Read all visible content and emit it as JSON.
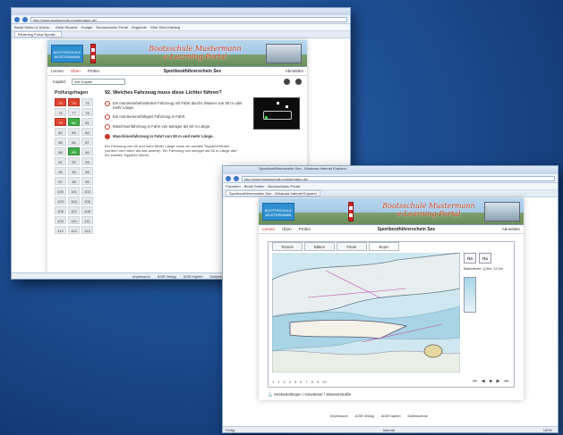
{
  "school": {
    "line1": "Bootsschule Mustermann",
    "line2": "e-Learning-Portal",
    "logo_text1": "BOOTSSCHULE",
    "logo_text2": "MUSTERMANN"
  },
  "window1": {
    "url": "http://www.bootsschule-mustermann.de/",
    "tab": "Elearning Portal Sportb...",
    "favs": [
      "Beste Seiten & Küche...",
      "Mehr Hinweis",
      "Google",
      "Bootsschulen Portal",
      "Angebote",
      "Web Slice-Katalog"
    ],
    "nav": {
      "learn": "Lernen",
      "test": "Üben",
      "exam": "Prüfen",
      "title": "Sportbootführerschein See",
      "user": "Abmelden"
    },
    "select_label": "Kapitel:",
    "select_value": "Alle Kapitel",
    "sidebar_title": "Prüfungsfragen",
    "question": "92. Welches Fahrzeug muss diese Lichter führen?",
    "grid": [
      {
        "n": "73",
        "s": "r"
      },
      {
        "n": "74",
        "s": "r"
      },
      {
        "n": "75",
        "s": ""
      },
      {
        "n": "76",
        "s": ""
      },
      {
        "n": "77",
        "s": ""
      },
      {
        "n": "78",
        "s": ""
      },
      {
        "n": "79",
        "s": "r"
      },
      {
        "n": "80",
        "s": "g"
      },
      {
        "n": "81",
        "s": ""
      },
      {
        "n": "82",
        "s": ""
      },
      {
        "n": "83",
        "s": ""
      },
      {
        "n": "84",
        "s": ""
      },
      {
        "n": "85",
        "s": ""
      },
      {
        "n": "86",
        "s": ""
      },
      {
        "n": "87",
        "s": ""
      },
      {
        "n": "88",
        "s": ""
      },
      {
        "n": "89",
        "s": "g"
      },
      {
        "n": "90",
        "s": ""
      },
      {
        "n": "91",
        "s": ""
      },
      {
        "n": "92",
        "s": ""
      },
      {
        "n": "93",
        "s": ""
      },
      {
        "n": "94",
        "s": ""
      },
      {
        "n": "95",
        "s": ""
      },
      {
        "n": "96",
        "s": ""
      },
      {
        "n": "97",
        "s": ""
      },
      {
        "n": "98",
        "s": ""
      },
      {
        "n": "99",
        "s": ""
      },
      {
        "n": "100",
        "s": ""
      },
      {
        "n": "101",
        "s": ""
      },
      {
        "n": "102",
        "s": ""
      },
      {
        "n": "103",
        "s": ""
      },
      {
        "n": "104",
        "s": ""
      },
      {
        "n": "105",
        "s": ""
      },
      {
        "n": "106",
        "s": ""
      },
      {
        "n": "107",
        "s": ""
      },
      {
        "n": "108",
        "s": ""
      },
      {
        "n": "109",
        "s": ""
      },
      {
        "n": "110",
        "s": ""
      },
      {
        "n": "111",
        "s": ""
      },
      {
        "n": "112",
        "s": ""
      },
      {
        "n": "113",
        "s": ""
      },
      {
        "n": "114",
        "s": ""
      }
    ],
    "answers": [
      "Ein manövrierbehindertes Fahrzeug mit Fahrt durchs Wasser von 50 m oder mehr Länge.",
      "Ein manövrierunfähiges Fahrzeug in Fahrt.",
      "Maschinenfahrzeug in Fahrt von weniger als 50 m Länge.",
      "Maschinenfahrzeug in Fahrt von 50 m und mehr Länge."
    ],
    "explanation": "Ein Fahrzeug von 50 und mehr Meter Länge muss ein zweites Topplicht führen (achtern und höher als das andere). Ein Fahrzeug von weniger als 50 m Länge darf ein zweites Topplicht führen.",
    "status": [
      "Impressum",
      "AGB Verlag",
      "AGB Kapitel",
      "Datenschutz"
    ]
  },
  "window2": {
    "url": "http://www.bootsschule-mustermann.de/",
    "tab": "Sportbootführerschein See - Windows Internet Explorer",
    "favs": [
      "Favoriten",
      "Beste Seiten",
      "Bootsschulen Portal"
    ],
    "nav": {
      "learn": "Lernen",
      "test": "Üben",
      "exam": "Prüfen",
      "title": "Sportbootführerschein See",
      "user": "Abmelden"
    },
    "map_tabs": [
      "Tonnen",
      "Baken",
      "Feuer",
      "Bojen"
    ],
    "right_btns": [
      "Ra",
      "Ra"
    ],
    "right_text": "Bakenfeuer: Q.Bm. 12.0m",
    "pager": [
      "1",
      "2",
      "3",
      "4",
      "5",
      "6",
      "7",
      "8",
      "9",
      "10"
    ],
    "footer": "Seekarte/Bojen / Gewässer / Wasserstraße",
    "status_left": "Fertig",
    "status_mid": "Internet",
    "status_zoom": "100%",
    "bottom_links": [
      "Impressum",
      "AGB Verlag",
      "AGB Kapitel",
      "Datenschutz"
    ]
  },
  "colors": {
    "accent_red": "#c0302b",
    "brand_blue": "#2e8fd0",
    "correct": "#3fae49",
    "wrong": "#e0452f"
  }
}
